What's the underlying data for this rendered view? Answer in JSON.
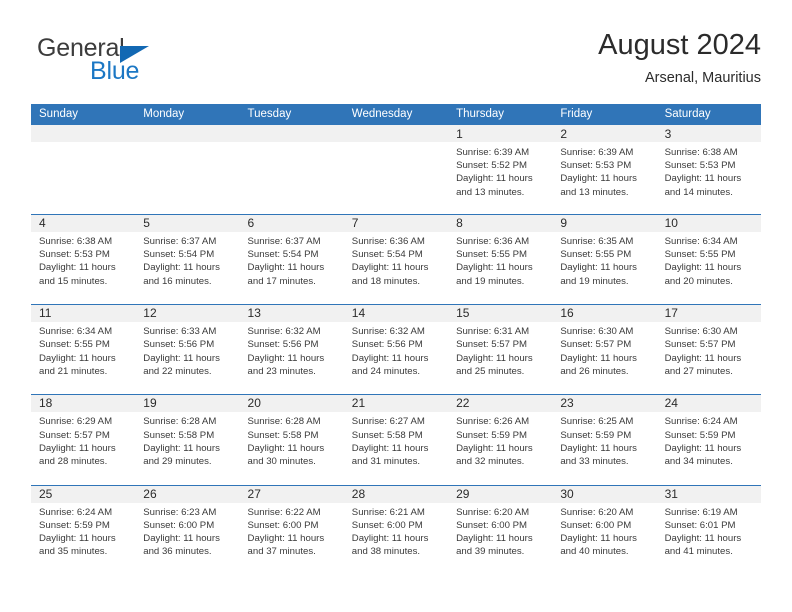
{
  "brand": {
    "name_part1": "General",
    "name_part2": "Blue",
    "triangle_icon": "triangle-icon"
  },
  "header": {
    "title": "August 2024",
    "subtitle": "Arsenal, Mauritius"
  },
  "colors": {
    "header_blue": "#3075b8",
    "daynum_band": "#f1f1f1",
    "brand_blue": "#1b77c4",
    "text": "#2b2b2b"
  },
  "weekdays": [
    "Sunday",
    "Monday",
    "Tuesday",
    "Wednesday",
    "Thursday",
    "Friday",
    "Saturday"
  ],
  "weeks": [
    [
      {
        "day": "",
        "sunrise": "",
        "sunset": "",
        "daylight1": "",
        "daylight2": ""
      },
      {
        "day": "",
        "sunrise": "",
        "sunset": "",
        "daylight1": "",
        "daylight2": ""
      },
      {
        "day": "",
        "sunrise": "",
        "sunset": "",
        "daylight1": "",
        "daylight2": ""
      },
      {
        "day": "",
        "sunrise": "",
        "sunset": "",
        "daylight1": "",
        "daylight2": ""
      },
      {
        "day": "1",
        "sunrise": "Sunrise: 6:39 AM",
        "sunset": "Sunset: 5:52 PM",
        "daylight1": "Daylight: 11 hours",
        "daylight2": "and 13 minutes."
      },
      {
        "day": "2",
        "sunrise": "Sunrise: 6:39 AM",
        "sunset": "Sunset: 5:53 PM",
        "daylight1": "Daylight: 11 hours",
        "daylight2": "and 13 minutes."
      },
      {
        "day": "3",
        "sunrise": "Sunrise: 6:38 AM",
        "sunset": "Sunset: 5:53 PM",
        "daylight1": "Daylight: 11 hours",
        "daylight2": "and 14 minutes."
      }
    ],
    [
      {
        "day": "4",
        "sunrise": "Sunrise: 6:38 AM",
        "sunset": "Sunset: 5:53 PM",
        "daylight1": "Daylight: 11 hours",
        "daylight2": "and 15 minutes."
      },
      {
        "day": "5",
        "sunrise": "Sunrise: 6:37 AM",
        "sunset": "Sunset: 5:54 PM",
        "daylight1": "Daylight: 11 hours",
        "daylight2": "and 16 minutes."
      },
      {
        "day": "6",
        "sunrise": "Sunrise: 6:37 AM",
        "sunset": "Sunset: 5:54 PM",
        "daylight1": "Daylight: 11 hours",
        "daylight2": "and 17 minutes."
      },
      {
        "day": "7",
        "sunrise": "Sunrise: 6:36 AM",
        "sunset": "Sunset: 5:54 PM",
        "daylight1": "Daylight: 11 hours",
        "daylight2": "and 18 minutes."
      },
      {
        "day": "8",
        "sunrise": "Sunrise: 6:36 AM",
        "sunset": "Sunset: 5:55 PM",
        "daylight1": "Daylight: 11 hours",
        "daylight2": "and 19 minutes."
      },
      {
        "day": "9",
        "sunrise": "Sunrise: 6:35 AM",
        "sunset": "Sunset: 5:55 PM",
        "daylight1": "Daylight: 11 hours",
        "daylight2": "and 19 minutes."
      },
      {
        "day": "10",
        "sunrise": "Sunrise: 6:34 AM",
        "sunset": "Sunset: 5:55 PM",
        "daylight1": "Daylight: 11 hours",
        "daylight2": "and 20 minutes."
      }
    ],
    [
      {
        "day": "11",
        "sunrise": "Sunrise: 6:34 AM",
        "sunset": "Sunset: 5:55 PM",
        "daylight1": "Daylight: 11 hours",
        "daylight2": "and 21 minutes."
      },
      {
        "day": "12",
        "sunrise": "Sunrise: 6:33 AM",
        "sunset": "Sunset: 5:56 PM",
        "daylight1": "Daylight: 11 hours",
        "daylight2": "and 22 minutes."
      },
      {
        "day": "13",
        "sunrise": "Sunrise: 6:32 AM",
        "sunset": "Sunset: 5:56 PM",
        "daylight1": "Daylight: 11 hours",
        "daylight2": "and 23 minutes."
      },
      {
        "day": "14",
        "sunrise": "Sunrise: 6:32 AM",
        "sunset": "Sunset: 5:56 PM",
        "daylight1": "Daylight: 11 hours",
        "daylight2": "and 24 minutes."
      },
      {
        "day": "15",
        "sunrise": "Sunrise: 6:31 AM",
        "sunset": "Sunset: 5:57 PM",
        "daylight1": "Daylight: 11 hours",
        "daylight2": "and 25 minutes."
      },
      {
        "day": "16",
        "sunrise": "Sunrise: 6:30 AM",
        "sunset": "Sunset: 5:57 PM",
        "daylight1": "Daylight: 11 hours",
        "daylight2": "and 26 minutes."
      },
      {
        "day": "17",
        "sunrise": "Sunrise: 6:30 AM",
        "sunset": "Sunset: 5:57 PM",
        "daylight1": "Daylight: 11 hours",
        "daylight2": "and 27 minutes."
      }
    ],
    [
      {
        "day": "18",
        "sunrise": "Sunrise: 6:29 AM",
        "sunset": "Sunset: 5:57 PM",
        "daylight1": "Daylight: 11 hours",
        "daylight2": "and 28 minutes."
      },
      {
        "day": "19",
        "sunrise": "Sunrise: 6:28 AM",
        "sunset": "Sunset: 5:58 PM",
        "daylight1": "Daylight: 11 hours",
        "daylight2": "and 29 minutes."
      },
      {
        "day": "20",
        "sunrise": "Sunrise: 6:28 AM",
        "sunset": "Sunset: 5:58 PM",
        "daylight1": "Daylight: 11 hours",
        "daylight2": "and 30 minutes."
      },
      {
        "day": "21",
        "sunrise": "Sunrise: 6:27 AM",
        "sunset": "Sunset: 5:58 PM",
        "daylight1": "Daylight: 11 hours",
        "daylight2": "and 31 minutes."
      },
      {
        "day": "22",
        "sunrise": "Sunrise: 6:26 AM",
        "sunset": "Sunset: 5:59 PM",
        "daylight1": "Daylight: 11 hours",
        "daylight2": "and 32 minutes."
      },
      {
        "day": "23",
        "sunrise": "Sunrise: 6:25 AM",
        "sunset": "Sunset: 5:59 PM",
        "daylight1": "Daylight: 11 hours",
        "daylight2": "and 33 minutes."
      },
      {
        "day": "24",
        "sunrise": "Sunrise: 6:24 AM",
        "sunset": "Sunset: 5:59 PM",
        "daylight1": "Daylight: 11 hours",
        "daylight2": "and 34 minutes."
      }
    ],
    [
      {
        "day": "25",
        "sunrise": "Sunrise: 6:24 AM",
        "sunset": "Sunset: 5:59 PM",
        "daylight1": "Daylight: 11 hours",
        "daylight2": "and 35 minutes."
      },
      {
        "day": "26",
        "sunrise": "Sunrise: 6:23 AM",
        "sunset": "Sunset: 6:00 PM",
        "daylight1": "Daylight: 11 hours",
        "daylight2": "and 36 minutes."
      },
      {
        "day": "27",
        "sunrise": "Sunrise: 6:22 AM",
        "sunset": "Sunset: 6:00 PM",
        "daylight1": "Daylight: 11 hours",
        "daylight2": "and 37 minutes."
      },
      {
        "day": "28",
        "sunrise": "Sunrise: 6:21 AM",
        "sunset": "Sunset: 6:00 PM",
        "daylight1": "Daylight: 11 hours",
        "daylight2": "and 38 minutes."
      },
      {
        "day": "29",
        "sunrise": "Sunrise: 6:20 AM",
        "sunset": "Sunset: 6:00 PM",
        "daylight1": "Daylight: 11 hours",
        "daylight2": "and 39 minutes."
      },
      {
        "day": "30",
        "sunrise": "Sunrise: 6:20 AM",
        "sunset": "Sunset: 6:00 PM",
        "daylight1": "Daylight: 11 hours",
        "daylight2": "and 40 minutes."
      },
      {
        "day": "31",
        "sunrise": "Sunrise: 6:19 AM",
        "sunset": "Sunset: 6:01 PM",
        "daylight1": "Daylight: 11 hours",
        "daylight2": "and 41 minutes."
      }
    ]
  ]
}
